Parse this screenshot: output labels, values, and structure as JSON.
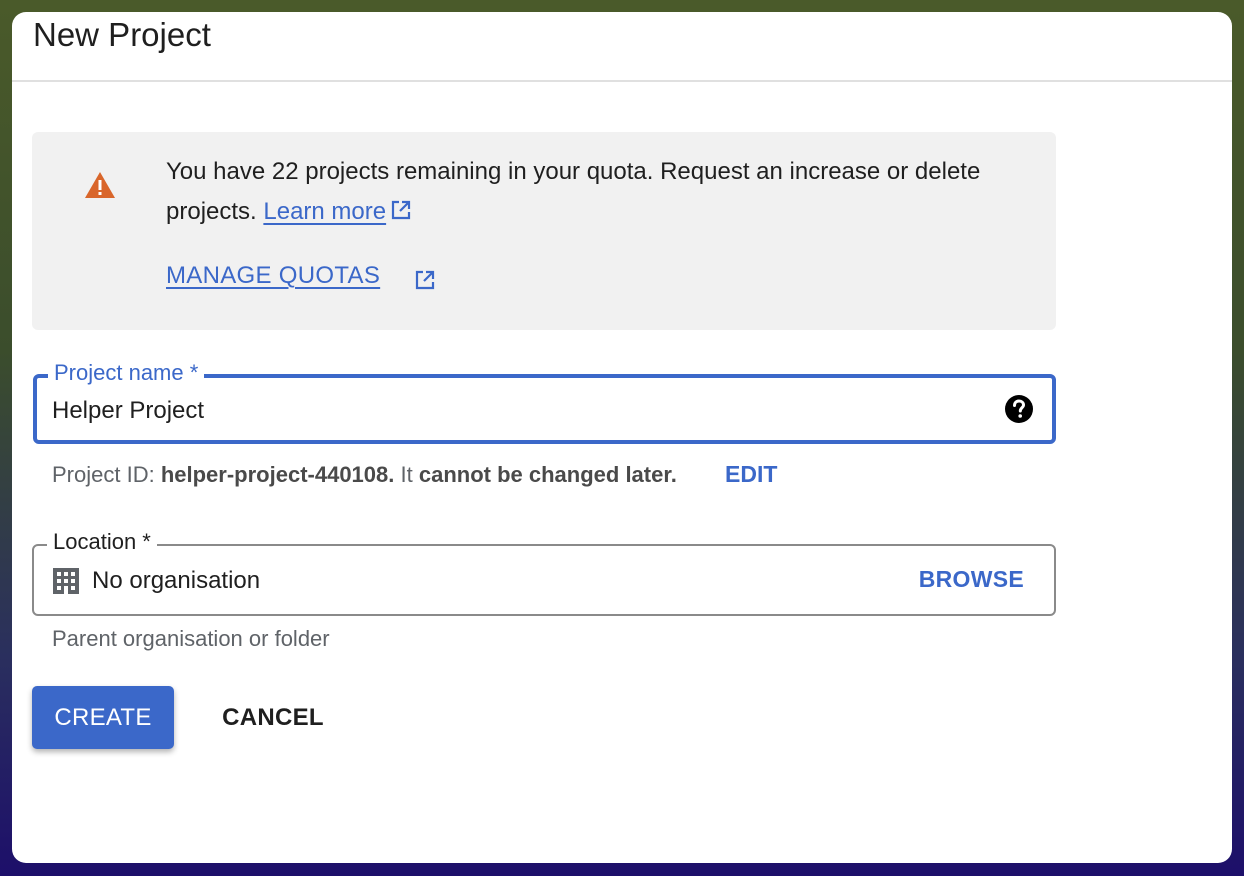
{
  "dialog": {
    "title": "New Project"
  },
  "quota": {
    "message": "You have 22 projects remaining in your quota. Request an increase or delete projects.",
    "learn_more": "Learn more",
    "manage_quotas": "MANAGE QUOTAS",
    "warning_icon": "warning-triangle-icon",
    "warning_color": "#d9662b"
  },
  "project_name": {
    "label": "Project name *",
    "value": "Helper Project",
    "help_icon": "help-circle-icon"
  },
  "project_id": {
    "prefix": "Project ID:",
    "value": "helper-project-440108.",
    "middle": "It",
    "emphasis": "cannot be changed later.",
    "edit_label": "EDIT"
  },
  "location": {
    "label": "Location *",
    "value": "No organisation",
    "browse_label": "BROWSE",
    "hint": "Parent organisation or folder",
    "icon": "building-icon"
  },
  "actions": {
    "create_label": "CREATE",
    "cancel_label": "CANCEL"
  },
  "colors": {
    "accent": "#3b68c9",
    "panel": "#f1f1f1"
  }
}
